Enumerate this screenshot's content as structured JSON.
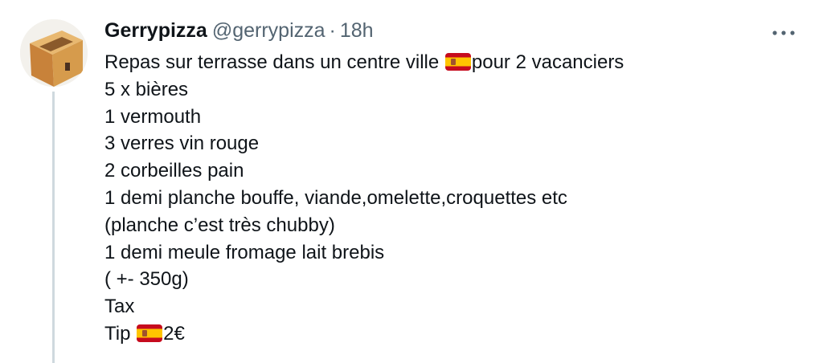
{
  "tweet": {
    "display_name": "Gerrypizza",
    "handle": "@gerrypizza",
    "separator": "·",
    "timestamp": "18h",
    "more_icon": "more-horizontal-icon",
    "avatar_icon": "cardboard-box-avatar",
    "lines": [
      {
        "before": "Repas sur terrasse dans un centre ville ",
        "flag": "spain-flag-icon",
        "after": "pour 2 vacanciers"
      },
      {
        "text": "5 x bières"
      },
      {
        "text": "1 vermouth"
      },
      {
        "text": "3 verres vin rouge"
      },
      {
        "text": "2 corbeilles pain"
      },
      {
        "text": "1 demi planche bouffe, viande,omelette,croquettes etc"
      },
      {
        "text": "(planche c’est très chubby)"
      },
      {
        "text": "1 demi meule fromage lait brebis"
      },
      {
        "text": "( +- 350g)"
      },
      {
        "text": "Tax"
      },
      {
        "before": "Tip ",
        "flag": "spain-flag-icon",
        "after": "2€"
      }
    ]
  },
  "colors": {
    "text": "#0f1419",
    "secondary": "#536471",
    "thread_line": "#cfd9de",
    "flag_red": "#c60b1e",
    "flag_yellow": "#ffc400"
  }
}
